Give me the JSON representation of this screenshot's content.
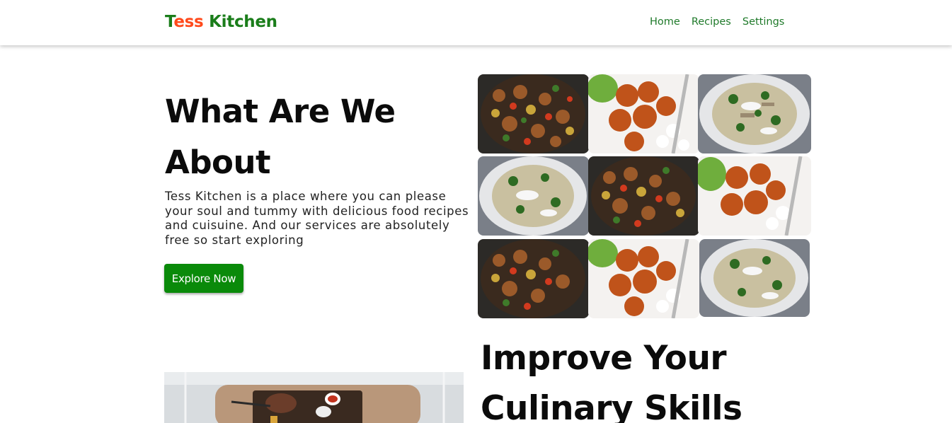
{
  "header": {
    "brand": {
      "part1": "T",
      "part2": "ess",
      "part3": " Kitchen"
    },
    "nav": [
      {
        "label": "Home"
      },
      {
        "label": "Recipes"
      },
      {
        "label": "Settings"
      }
    ]
  },
  "hero": {
    "title": "What Are We About",
    "description": "Tess Kitchen is a place where you can please your soul and tummy with delicious food recipes and cuisuine. And our services are absolutely free so start exploring",
    "button_label": "Explore Now"
  },
  "food_grid": {
    "tiles": [
      {
        "icon": "stir-fry-image"
      },
      {
        "icon": "sesame-chicken-image"
      },
      {
        "icon": "chicken-broccoli-rice-image"
      },
      {
        "icon": "chicken-broccoli-rice-image"
      },
      {
        "icon": "stir-fry-image"
      },
      {
        "icon": "sesame-chicken-image"
      },
      {
        "icon": "stir-fry-image"
      },
      {
        "icon": "sesame-chicken-image"
      },
      {
        "icon": "chicken-broccoli-rice-image"
      }
    ]
  },
  "section2": {
    "title": "Improve Your Culinary Skills",
    "image_icon": "steak-board-image"
  },
  "colors": {
    "brand_green": "#1a7d1a",
    "brand_orange": "#ff4a1c",
    "nav_green": "#1f7a2a",
    "button_green": "#0a8a0a"
  }
}
